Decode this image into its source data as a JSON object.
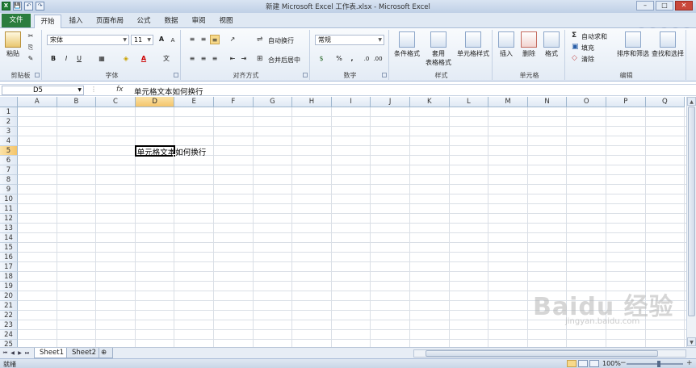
{
  "window": {
    "title": "新建 Microsoft Excel 工作表.xlsx - Microsoft Excel",
    "qat": [
      "X",
      "💾",
      "↶",
      "↷"
    ],
    "controls": {
      "min": "–",
      "max": "□",
      "close": "✕"
    }
  },
  "tabs": [
    {
      "label": "文件"
    },
    {
      "label": "开始"
    },
    {
      "label": "插入"
    },
    {
      "label": "页面布局"
    },
    {
      "label": "公式"
    },
    {
      "label": "数据"
    },
    {
      "label": "审阅"
    },
    {
      "label": "视图"
    }
  ],
  "ribbon": {
    "clipboard": {
      "group": "剪贴板",
      "paste": "粘贴"
    },
    "font": {
      "group": "字体",
      "family": "宋体",
      "size": "11",
      "grow": "A",
      "shrink": "A",
      "bold": "B",
      "italic": "I",
      "underline": "U",
      "fontcolor": "A",
      "wen": "文"
    },
    "alignment": {
      "group": "对齐方式",
      "wrap": "自动换行",
      "merge": "合并后居中"
    },
    "number": {
      "group": "数字",
      "format": "常规",
      "percent": "%",
      "comma": ","
    },
    "styles": {
      "group": "样式",
      "cond": "条件格式",
      "table1": "套用",
      "table2": "表格格式",
      "cell": "单元格样式"
    },
    "cells": {
      "group": "单元格",
      "insert": "插入",
      "delete": "删除",
      "format": "格式"
    },
    "editing": {
      "group": "编辑",
      "autosum": "自动求和",
      "fill": "填充",
      "clear": "清除",
      "sort": "排序和筛选",
      "find": "查找和选择"
    }
  },
  "formula_bar": {
    "name_box": "D5",
    "fx": "fx",
    "content": "单元格文本如何换行"
  },
  "grid": {
    "columns": [
      "A",
      "B",
      "C",
      "D",
      "E",
      "F",
      "G",
      "H",
      "I",
      "J",
      "K",
      "L",
      "M",
      "N",
      "O",
      "P",
      "Q"
    ],
    "rows": [
      "1",
      "2",
      "3",
      "4",
      "5",
      "6",
      "7",
      "8",
      "9",
      "10",
      "11",
      "12",
      "13",
      "14",
      "15",
      "16",
      "17",
      "18",
      "19",
      "20",
      "21",
      "22",
      "23",
      "24",
      "25"
    ],
    "selected_column": "D",
    "selected_row": "5",
    "cell_text": "单元格文本如何换行"
  },
  "sheets": [
    {
      "label": "Sheet1"
    },
    {
      "label": "Sheet2"
    }
  ],
  "status": {
    "ready": "就绪",
    "zoom": "100%",
    "zoom_minus": "−",
    "zoom_plus": "+"
  },
  "watermark": {
    "brand": "Baidu 经验",
    "url": "jingyan.baidu.com"
  },
  "colors": {
    "accent": "#2b7d3e",
    "selected_header": "#f4c46a",
    "ribbon": "#e3ebf5"
  }
}
